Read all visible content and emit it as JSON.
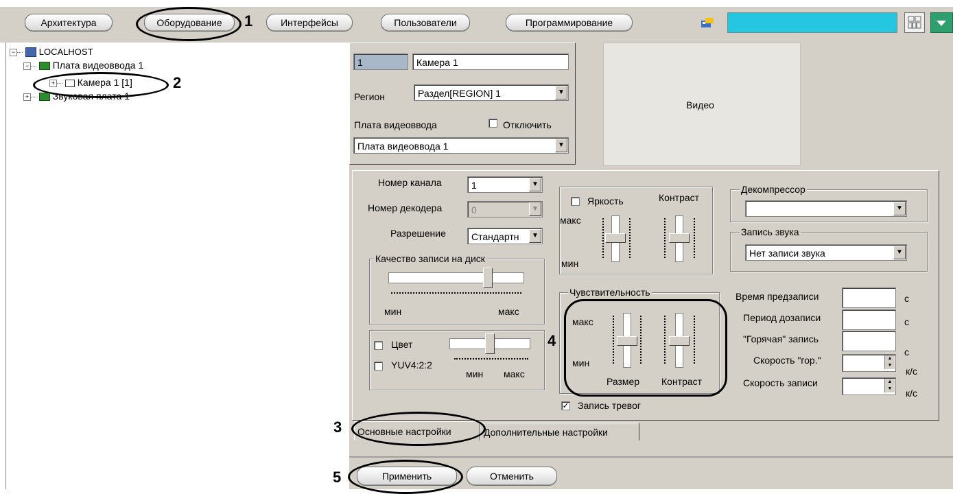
{
  "toolbar": {
    "tabs": [
      "Архитектура",
      "Оборудование",
      "Интерфейсы",
      "Пользователи",
      "Программирование"
    ]
  },
  "callouts": [
    "1",
    "2",
    "3",
    "4",
    "5"
  ],
  "tree": {
    "root": "LOCALHOST",
    "board": "Плата видеоввода 1",
    "camera": "Камера 1 [1]",
    "sound": "Звуковая плата 1"
  },
  "object": {
    "id": "1",
    "name": "Камера 1",
    "region_label": "Регион",
    "region_value": "Раздел[REGION] 1",
    "board_label": "Плата видеоввода",
    "disable_label": "Отключить",
    "board_value": "Плата видеоввода 1",
    "video_label": "Видео"
  },
  "basic": {
    "channel_label": "Номер канала",
    "channel_value": "1",
    "decoder_label": "Номер декодера",
    "decoder_value": "0",
    "resolution_label": "Разрешение",
    "resolution_value": "Стандартн",
    "quality_title": "Качество записи на диск",
    "min": "мин",
    "max": "макс",
    "color_label": "Цвет",
    "yuv_label": "YUV4:2:2",
    "brightness_label": "Яркость",
    "contrast_label": "Контраст",
    "sensitivity_title": "Чувствительность",
    "size_label": "Размер",
    "decompressor_title": "Декомпрессор",
    "decompressor_value": "",
    "sound_title": "Запись звука",
    "sound_value": "Нет записи звука",
    "prerecord_label": "Время предзаписи",
    "postrecord_label": "Период дозаписи",
    "hot_label": "\"Горячая\" запись",
    "hot_speed_label": "Скорость \"гор.\"",
    "rec_speed_label": "Скорость записи",
    "unit_s": "с",
    "unit_fps": "к/с",
    "alarm_label": "Запись тревог",
    "quality_level": 0.75
  },
  "tabs": {
    "basic": "Основные настройки",
    "advanced": "Дополнительные настройки"
  },
  "buttons": {
    "apply": "Применить",
    "cancel": "Отменить"
  }
}
